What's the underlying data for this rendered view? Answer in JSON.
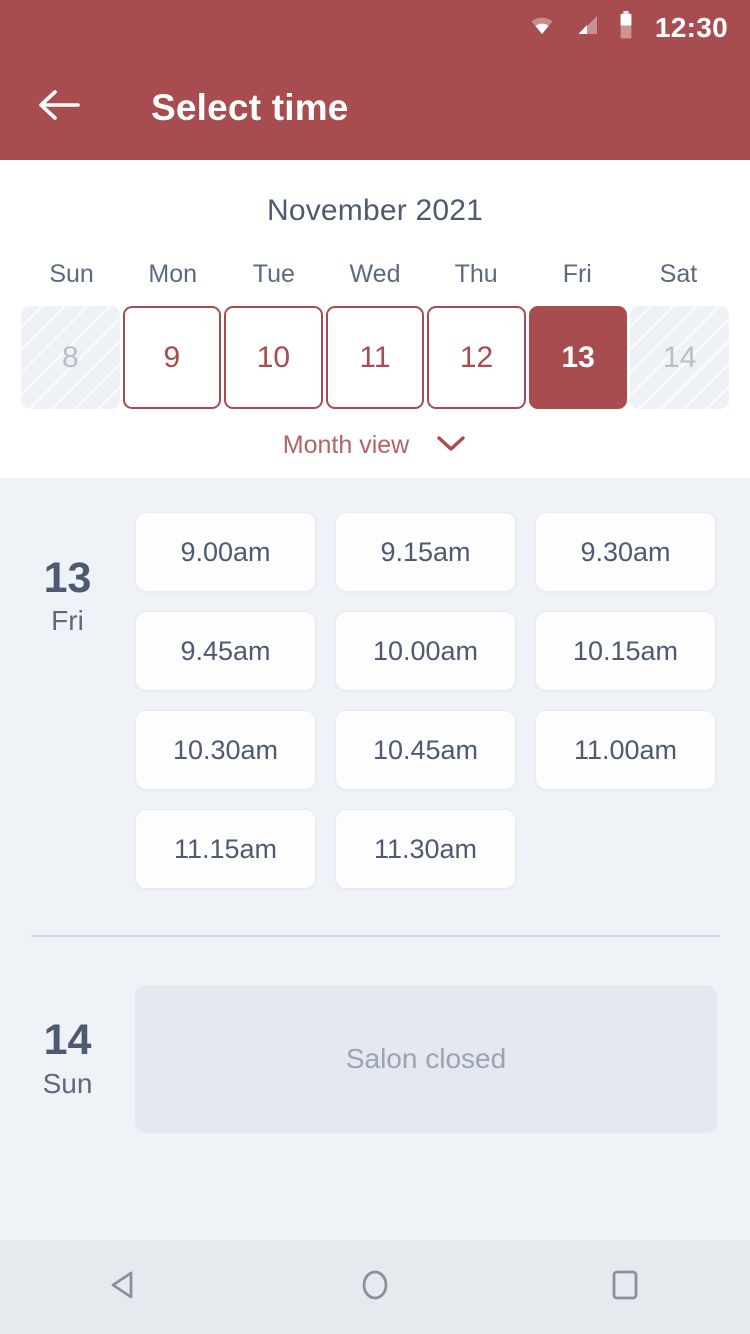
{
  "statusbar": {
    "clock": "12:30",
    "icons": [
      "wifi-icon",
      "cellular-signal-icon",
      "battery-icon"
    ]
  },
  "appbar": {
    "back_icon": "back-arrow-icon",
    "title": "Select time"
  },
  "calendar": {
    "month_title": "November 2021",
    "day_names": [
      "Sun",
      "Mon",
      "Tue",
      "Wed",
      "Thu",
      "Fri",
      "Sat"
    ],
    "days": [
      {
        "num": "8",
        "state": "disabled"
      },
      {
        "num": "9",
        "state": "available"
      },
      {
        "num": "10",
        "state": "available"
      },
      {
        "num": "11",
        "state": "available"
      },
      {
        "num": "12",
        "state": "available"
      },
      {
        "num": "13",
        "state": "selected"
      },
      {
        "num": "14",
        "state": "disabled"
      }
    ],
    "month_view_label": "Month view",
    "month_view_chevron": "chevron-down-icon"
  },
  "schedule": {
    "day_13": {
      "date_number": "13",
      "day_name": "Fri",
      "slots": [
        "9.00am",
        "9.15am",
        "9.30am",
        "9.45am",
        "10.00am",
        "10.15am",
        "10.30am",
        "10.45am",
        "11.00am",
        "11.15am",
        "11.30am"
      ]
    },
    "day_14": {
      "date_number": "14",
      "day_name": "Sun",
      "closed_message": "Salon closed"
    }
  },
  "navbar": {
    "back": "android-back-icon",
    "home": "android-home-icon",
    "recents": "android-recents-icon"
  },
  "colors": {
    "brand": "#a84d4f",
    "page_bg": "#eff2f7",
    "text_dark": "#4d5a72",
    "text_muted": "#9aa4b5"
  }
}
